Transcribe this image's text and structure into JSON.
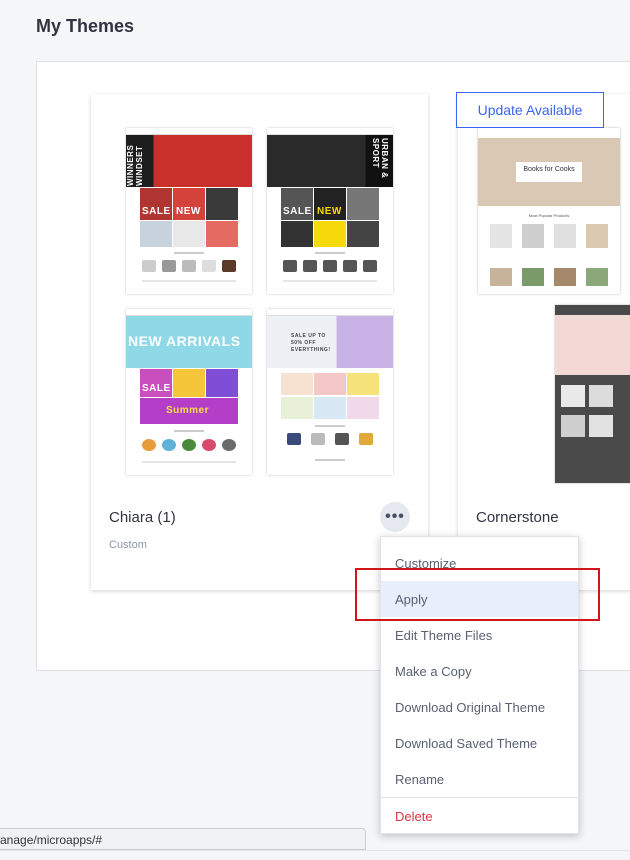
{
  "page": {
    "title": "My Themes"
  },
  "themes": [
    {
      "name": "Chiara (1)",
      "subtitle": "Custom"
    },
    {
      "name": "Cornerstone",
      "badge": "Update Available"
    }
  ],
  "thumbnails": {
    "chiara_windset": {
      "hero": "WINNERS WINDSET",
      "tag1": "SALE",
      "tag2": "NEW"
    },
    "chiara_urban": {
      "hero": "URBAN & SPORT",
      "tag1": "SALE",
      "tag2": "NEW"
    },
    "chiara_new": {
      "hero": "NEW ARRIVALS",
      "tag1": "SALE",
      "tag2": "Summer"
    },
    "chiara_sale": {
      "hero": "SALE UP TO 50% OFF EVERYTHING!"
    },
    "cornerstone": {
      "hero": "Books for Cooks",
      "section": "Most Popular Products"
    }
  },
  "context_menu": {
    "items": [
      "Customize",
      "Apply",
      "Edit Theme Files",
      "Make a Copy",
      "Download Original Theme",
      "Download Saved Theme",
      "Rename"
    ],
    "danger_item": "Delete",
    "selected": "Apply"
  },
  "status_bar": {
    "url": "anage/microapps/#"
  },
  "colors": {
    "accent": "#3c64f4",
    "danger": "#db3643",
    "highlight": "#d0161b",
    "selected_bg": "#e8eefa"
  }
}
